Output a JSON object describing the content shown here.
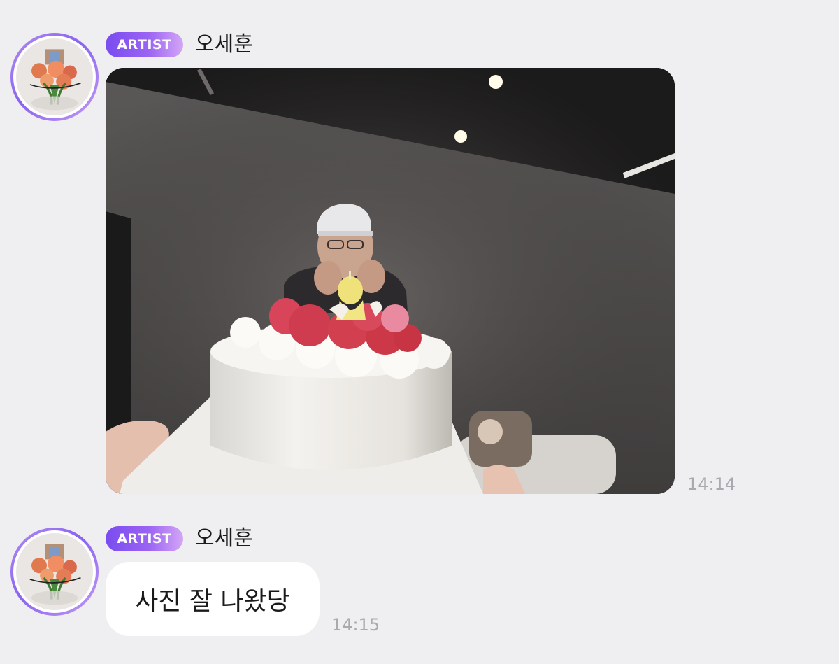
{
  "messages": [
    {
      "badge": "ARTIST",
      "sender": "오세훈",
      "type": "image",
      "time": "14:14"
    },
    {
      "badge": "ARTIST",
      "sender": "오세훈",
      "type": "text",
      "text": "사진 잘 나왔당",
      "time": "14:15"
    }
  ],
  "colors": {
    "background": "#efeff1",
    "badge_start": "#7a4cf0",
    "badge_end": "#d3a6f6",
    "avatar_ring": "#8a63f0",
    "timestamp": "#a9a9ae"
  },
  "icons": [
    "profile-avatar"
  ]
}
